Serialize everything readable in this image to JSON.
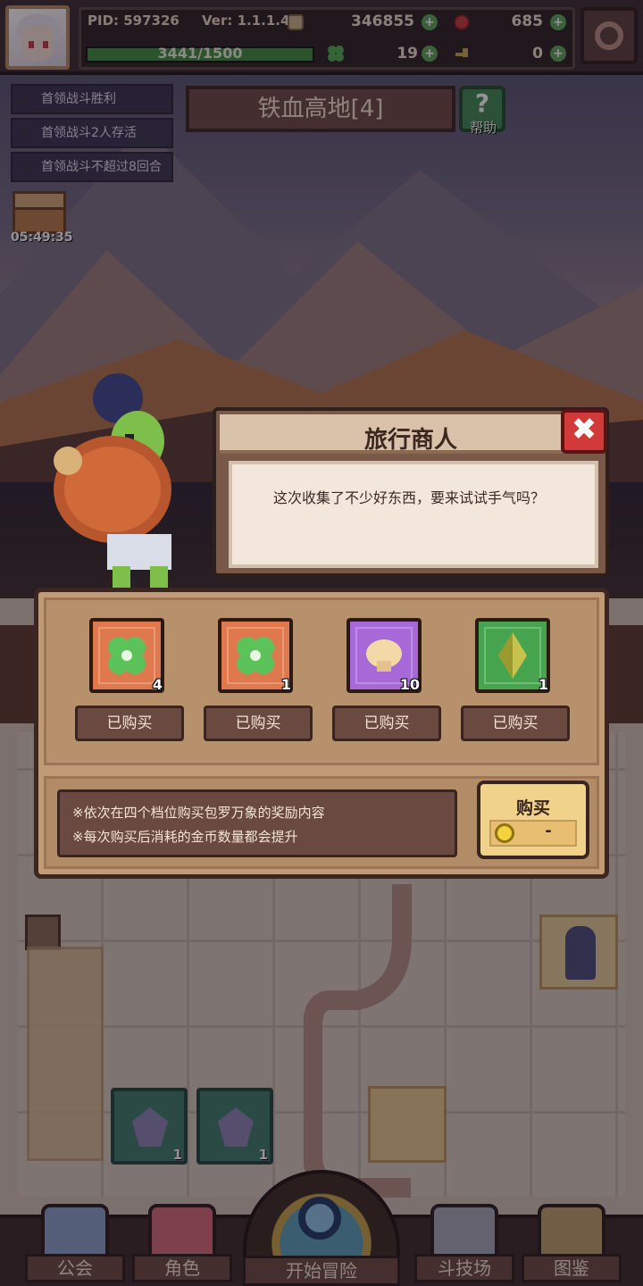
{
  "hud": {
    "pid": "PID: 597326",
    "version": "Ver: 1.1.1.4",
    "coins": "346855",
    "gems": "685",
    "xp": "3441/1500",
    "xp_fraction": 1.0,
    "clovers": "19",
    "keys": "0"
  },
  "quests": [
    "首领战斗胜利",
    "首领战斗2人存活",
    "首领战斗不超过8回合"
  ],
  "chest_timer": "05:49:35",
  "stage": {
    "title": "铁血高地[4]",
    "help_label": "帮助",
    "help_icon": "?"
  },
  "dialog": {
    "title": "旅行商人",
    "message": "这次收集了不少好东西，要来试试手气吗？",
    "close_icon": "✖"
  },
  "shop": {
    "items": [
      {
        "icon": "clover-icon",
        "count": "4",
        "status": "已购买"
      },
      {
        "icon": "clover-icon",
        "count": "1",
        "status": "已购买"
      },
      {
        "icon": "mushroom-icon",
        "count": "10",
        "status": "已购买"
      },
      {
        "icon": "crystal-icon",
        "count": "1",
        "status": "已购买"
      }
    ],
    "note_1": "※依次在四个档位购买包罗万象的奖励内容",
    "note_2": "※每次购买后消耗的金币数量都会提升",
    "buy_label": "购买",
    "buy_price": "-"
  },
  "board": {
    "cards": [
      {
        "count": "1"
      },
      {
        "count": "1"
      }
    ]
  },
  "nav": {
    "guild": "公会",
    "character": "角色",
    "start": "开始冒险",
    "arena": "斗技场",
    "codex": "图鉴"
  },
  "colors": {
    "accent_gold": "#f0d28a",
    "close_red": "#d23a3a",
    "panel_brown": "#c19a76"
  }
}
